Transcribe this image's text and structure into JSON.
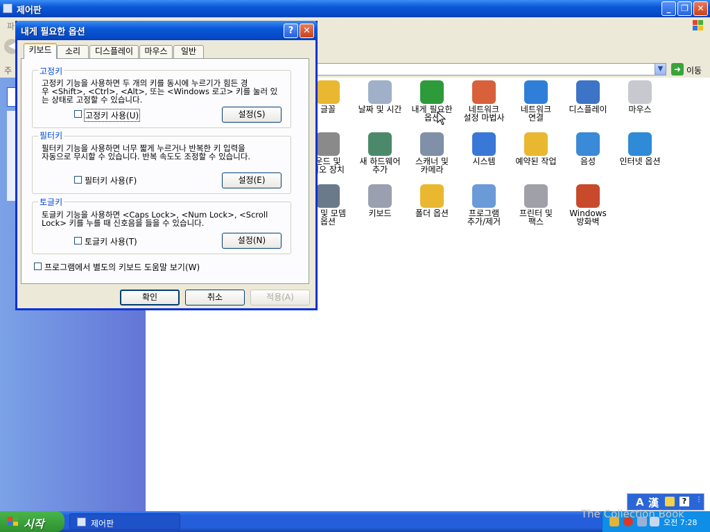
{
  "main_window": {
    "title": "제어판",
    "menu_partial": "파",
    "address_partial": "주",
    "go_label": "이동"
  },
  "control_panel_items": [
    {
      "label_lines": [
        "글꼴"
      ],
      "icon": "fonts-folder-icon",
      "color": "#e9b830"
    },
    {
      "label_lines": [
        "날짜 및 시간"
      ],
      "icon": "clock-calendar-icon",
      "color": "#9fb0c8"
    },
    {
      "label_lines": [
        "내게 필요한",
        "옵션"
      ],
      "icon": "accessibility-icon",
      "color": "#2d9b3a"
    },
    {
      "label_lines": [
        "네트워크",
        "설정 마법사"
      ],
      "icon": "network-house-icon",
      "color": "#d8603a"
    },
    {
      "label_lines": [
        "네트워크",
        "연결"
      ],
      "icon": "globe-network-icon",
      "color": "#2f7fd8"
    },
    {
      "label_lines": [
        "디스플레이"
      ],
      "icon": "display-icon",
      "color": "#3d74c8"
    },
    {
      "label_lines": [
        "마우스"
      ],
      "icon": "mouse-icon",
      "color": "#c8c8d0"
    },
    {
      "label_lines": [
        "운드 및",
        "디오 장치"
      ],
      "icon": "speaker-icon",
      "color": "#8a8a8a"
    },
    {
      "label_lines": [
        "새 하드웨어",
        "추가"
      ],
      "icon": "hardware-icon",
      "color": "#4a8a6a"
    },
    {
      "label_lines": [
        "스캐너 및",
        "카메라"
      ],
      "icon": "scanner-camera-icon",
      "color": "#8090a8"
    },
    {
      "label_lines": [
        "시스템"
      ],
      "icon": "system-computer-icon",
      "color": "#3a78d8"
    },
    {
      "label_lines": [
        "예약된 작업"
      ],
      "icon": "scheduled-tasks-icon",
      "color": "#e9b830"
    },
    {
      "label_lines": [
        "음성"
      ],
      "icon": "speech-icon",
      "color": "#3a8ad8"
    },
    {
      "label_lines": [
        "인터넷 옵션"
      ],
      "icon": "internet-options-icon",
      "color": "#2f8ad8"
    },
    {
      "label_lines": [
        "화 및 모뎀",
        "옵션"
      ],
      "icon": "phone-modem-icon",
      "color": "#6a7a8a"
    },
    {
      "label_lines": [
        "키보드"
      ],
      "icon": "keyboard-icon",
      "color": "#9aa0b0"
    },
    {
      "label_lines": [
        "폴더 옵션"
      ],
      "icon": "folder-options-icon",
      "color": "#e9b830"
    },
    {
      "label_lines": [
        "프로그램",
        "추가/제거"
      ],
      "icon": "add-remove-programs-icon",
      "color": "#6a9ad8"
    },
    {
      "label_lines": [
        "프린터 및",
        "팩스"
      ],
      "icon": "printer-fax-icon",
      "color": "#a0a0a8"
    },
    {
      "label_lines": [
        "Windows",
        "방화벽"
      ],
      "icon": "firewall-icon",
      "color": "#c84a2a"
    }
  ],
  "dialog": {
    "title": "내게 필요한 옵션",
    "tabs": [
      "키보드",
      "소리",
      "디스플레이",
      "마우스",
      "일반"
    ],
    "active_tab": "키보드",
    "sticky": {
      "title": "고정키",
      "desc_lines": [
        "고정키 기능을 사용하면 두 개의 키를 동시에 누르기가 힘든 경",
        "우 <Shift>, <Ctrl>, <Alt>, 또는 <Windows 로고> 키를 눌러 있",
        "는 상태로 고정할 수 있습니다."
      ],
      "checkbox": "고정키 사용(U)",
      "button": "설정(S)"
    },
    "filter": {
      "title": "필터키",
      "desc_lines": [
        "필터키 기능을 사용하면 너무 짧게 누르거나 반복한 키 입력을",
        "자동으로 무시할 수 있습니다. 반복 속도도 조정할 수 있습니다."
      ],
      "checkbox": "필터키 사용(F)",
      "button": "설정(E)"
    },
    "toggle": {
      "title": "토글키",
      "desc_lines": [
        "토글키 기능을 사용하면 <Caps Lock>, <Num Lock>, <Scroll",
        "Lock> 키를 누를 때 신호음을 들을 수 있습니다."
      ],
      "checkbox": "토글키 사용(T)",
      "button": "설정(N)"
    },
    "extra_checkbox": "프로그램에서 별도의 키보드 도움말 보기(W)",
    "ok": "확인",
    "cancel": "취소",
    "apply": "적용(A)"
  },
  "taskbar": {
    "start": "시작",
    "task": "제어판",
    "clock": "오전 7:28",
    "langbar_a": "A",
    "langbar_han": "漢"
  },
  "watermark": "The Collection Book"
}
